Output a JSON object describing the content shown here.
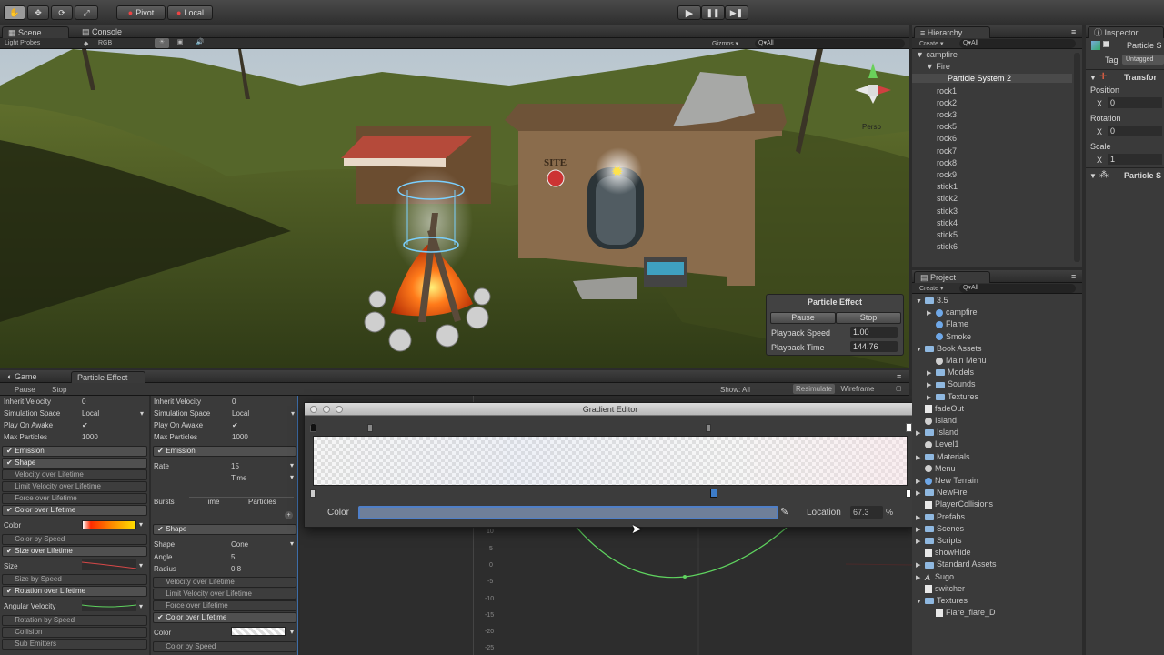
{
  "toolbar": {
    "pivot": "Pivot",
    "local": "Local",
    "play_controls": [
      "▶",
      "❚❚",
      "▶❚"
    ]
  },
  "scene": {
    "tabs": [
      "Scene",
      "Console"
    ],
    "subbar": {
      "light_probes": "Light Probes",
      "rgb": "RGB",
      "gizmos": "Gizmos ▾",
      "search": "Q▾All"
    },
    "persp": "Persp",
    "sign": "SITE"
  },
  "particle_effect": {
    "title": "Particle Effect",
    "pause": "Pause",
    "stop": "Stop",
    "playback_speed_label": "Playback Speed",
    "playback_speed": "1.00",
    "playback_time_label": "Playback Time",
    "playback_time": "144.76"
  },
  "bottom": {
    "tabs": [
      "Game",
      "Particle Effect"
    ],
    "pause": "Pause",
    "stop": "Stop",
    "show": "Show: All",
    "resimulate": "Resimulate",
    "wireframe": "Wireframe"
  },
  "col1": {
    "rows": [
      {
        "label": "Inherit Velocity",
        "value": "0"
      },
      {
        "label": "Simulation Space",
        "value": "Local"
      },
      {
        "label": "Play On Awake",
        "value": "✔"
      },
      {
        "label": "Max Particles",
        "value": "1000"
      }
    ],
    "modules_a": [
      {
        "label": "Emission",
        "checked": "✔",
        "on": true
      },
      {
        "label": "Shape",
        "checked": "✔",
        "on": true
      },
      {
        "label": "Velocity over Lifetime",
        "checked": "",
        "on": false
      },
      {
        "label": "Limit Velocity over Lifetime",
        "checked": "",
        "on": false
      },
      {
        "label": "Force over Lifetime",
        "checked": "",
        "on": false
      },
      {
        "label": "Color over Lifetime",
        "checked": "✔",
        "on": true
      }
    ],
    "color_label": "Color",
    "color_by_speed": "Color by Speed",
    "size_over_lifetime": "Size over Lifetime",
    "size_label": "Size",
    "size_by_speed": "Size by Speed",
    "rotation_over_lifetime": "Rotation over Lifetime",
    "angular_velocity": "Angular Velocity",
    "rotation_by_speed": "Rotation by Speed",
    "collision": "Collision",
    "sub_emitters": "Sub Emitters",
    "checkmark": "✔"
  },
  "col2": {
    "rows": [
      {
        "label": "Inherit Velocity",
        "value": "0"
      },
      {
        "label": "Simulation Space",
        "value": "Local"
      },
      {
        "label": "Play On Awake",
        "value": "✔"
      },
      {
        "label": "Max Particles",
        "value": "1000"
      }
    ],
    "emission": "Emission",
    "rate_label": "Rate",
    "rate_value": "15",
    "rate_unit": "Time",
    "bursts_label": "Bursts",
    "bursts_time": "Time",
    "bursts_particles": "Particles",
    "shape": "Shape",
    "shape_label": "Shape",
    "shape_value": "Cone",
    "angle_label": "Angle",
    "angle_value": "5",
    "radius_label": "Radius",
    "radius_value": "0.8",
    "modules": [
      "Velocity over Lifetime",
      "Limit Velocity over Lifetime",
      "Force over Lifetime"
    ],
    "color_over_lifetime": "Color over Lifetime",
    "color_label": "Color",
    "color_by_speed": "Color by Speed",
    "checkmark": "✔"
  },
  "gradient_editor": {
    "title": "Gradient Editor",
    "color_label": "Color",
    "location_label": "Location",
    "location_value": "67.3",
    "percent": "%"
  },
  "curve": {
    "y_ticks": [
      "10",
      "5",
      "0",
      "-5",
      "-10",
      "-15",
      "-20",
      "-25"
    ]
  },
  "hierarchy": {
    "title": "Hierarchy",
    "create": "Create ▾",
    "search": "Q▾All",
    "items": [
      {
        "label": "▼ campfire",
        "indent": 0
      },
      {
        "label": "▼ Fire",
        "indent": 1
      },
      {
        "label": "Particle System 2",
        "indent": 2,
        "selected": true
      },
      {
        "label": "rock1",
        "indent": 1
      },
      {
        "label": "rock2",
        "indent": 1
      },
      {
        "label": "rock3",
        "indent": 1
      },
      {
        "label": "rock5",
        "indent": 1
      },
      {
        "label": "rock6",
        "indent": 1
      },
      {
        "label": "rock7",
        "indent": 1
      },
      {
        "label": "rock8",
        "indent": 1
      },
      {
        "label": "rock9",
        "indent": 1
      },
      {
        "label": "stick1",
        "indent": 1
      },
      {
        "label": "stick2",
        "indent": 1
      },
      {
        "label": "stick3",
        "indent": 1
      },
      {
        "label": "stick4",
        "indent": 1
      },
      {
        "label": "stick5",
        "indent": 1
      },
      {
        "label": "stick6",
        "indent": 1
      }
    ]
  },
  "project": {
    "title": "Project",
    "create": "Create ▾",
    "search": "Q▾All",
    "items": [
      {
        "label": "3.5",
        "arrow": "▼",
        "icon": "folder",
        "indent": 0
      },
      {
        "label": "campfire",
        "arrow": "▶",
        "icon": "prefab",
        "indent": 1
      },
      {
        "label": "Flame",
        "arrow": "",
        "icon": "prefab",
        "indent": 1
      },
      {
        "label": "Smoke",
        "arrow": "",
        "icon": "prefab",
        "indent": 1
      },
      {
        "label": "Book Assets",
        "arrow": "▼",
        "icon": "folder",
        "indent": 0
      },
      {
        "label": "Main Menu",
        "arrow": "",
        "icon": "scene",
        "indent": 1
      },
      {
        "label": "Models",
        "arrow": "▶",
        "icon": "folder",
        "indent": 1
      },
      {
        "label": "Sounds",
        "arrow": "▶",
        "icon": "folder",
        "indent": 1
      },
      {
        "label": "Textures",
        "arrow": "▶",
        "icon": "folder",
        "indent": 1
      },
      {
        "label": "fadeOut",
        "arrow": "",
        "icon": "file",
        "indent": 0
      },
      {
        "label": "Island",
        "arrow": "",
        "icon": "scene",
        "indent": 0
      },
      {
        "label": "Island",
        "arrow": "▶",
        "icon": "folder",
        "indent": 0
      },
      {
        "label": "Level1",
        "arrow": "",
        "icon": "scene",
        "indent": 0
      },
      {
        "label": "Materials",
        "arrow": "▶",
        "icon": "folder",
        "indent": 0
      },
      {
        "label": "Menu",
        "arrow": "",
        "icon": "scene",
        "indent": 0
      },
      {
        "label": "New Terrain",
        "arrow": "▶",
        "icon": "prefab",
        "indent": 0
      },
      {
        "label": "NewFire",
        "arrow": "▶",
        "icon": "folder",
        "indent": 0
      },
      {
        "label": "PlayerCollisions",
        "arrow": "",
        "icon": "file",
        "indent": 0
      },
      {
        "label": "Prefabs",
        "arrow": "▶",
        "icon": "folder",
        "indent": 0
      },
      {
        "label": "Scenes",
        "arrow": "▶",
        "icon": "folder",
        "indent": 0
      },
      {
        "label": "Scripts",
        "arrow": "▶",
        "icon": "folder",
        "indent": 0
      },
      {
        "label": "showHide",
        "arrow": "",
        "icon": "file",
        "indent": 0
      },
      {
        "label": "Standard Assets",
        "arrow": "▶",
        "icon": "folder",
        "indent": 0
      },
      {
        "label": "Sugo",
        "arrow": "▶",
        "icon": "font",
        "indent": 0
      },
      {
        "label": "switcher",
        "arrow": "",
        "icon": "file",
        "indent": 0
      },
      {
        "label": "Textures",
        "arrow": "▼",
        "icon": "folder",
        "indent": 0
      },
      {
        "label": "Flare_flare_D",
        "arrow": "",
        "icon": "file",
        "indent": 1
      }
    ]
  },
  "inspector": {
    "title": "Inspector",
    "object_name": "Particle S",
    "tag_label": "Tag",
    "tag_value": "Untagged",
    "transform": "Transfor",
    "position_label": "Position",
    "rotation_label": "Rotation",
    "scale_label": "Scale",
    "x_label": "X",
    "position_x": "0",
    "rotation_x": "0",
    "scale_x": "1",
    "particle_system": "Particle S"
  },
  "colors": {
    "selection": "#3d6da8",
    "curve": "#5fd35f",
    "gradient_start": "#ff2a00",
    "gradient_end": "#ffe000"
  }
}
